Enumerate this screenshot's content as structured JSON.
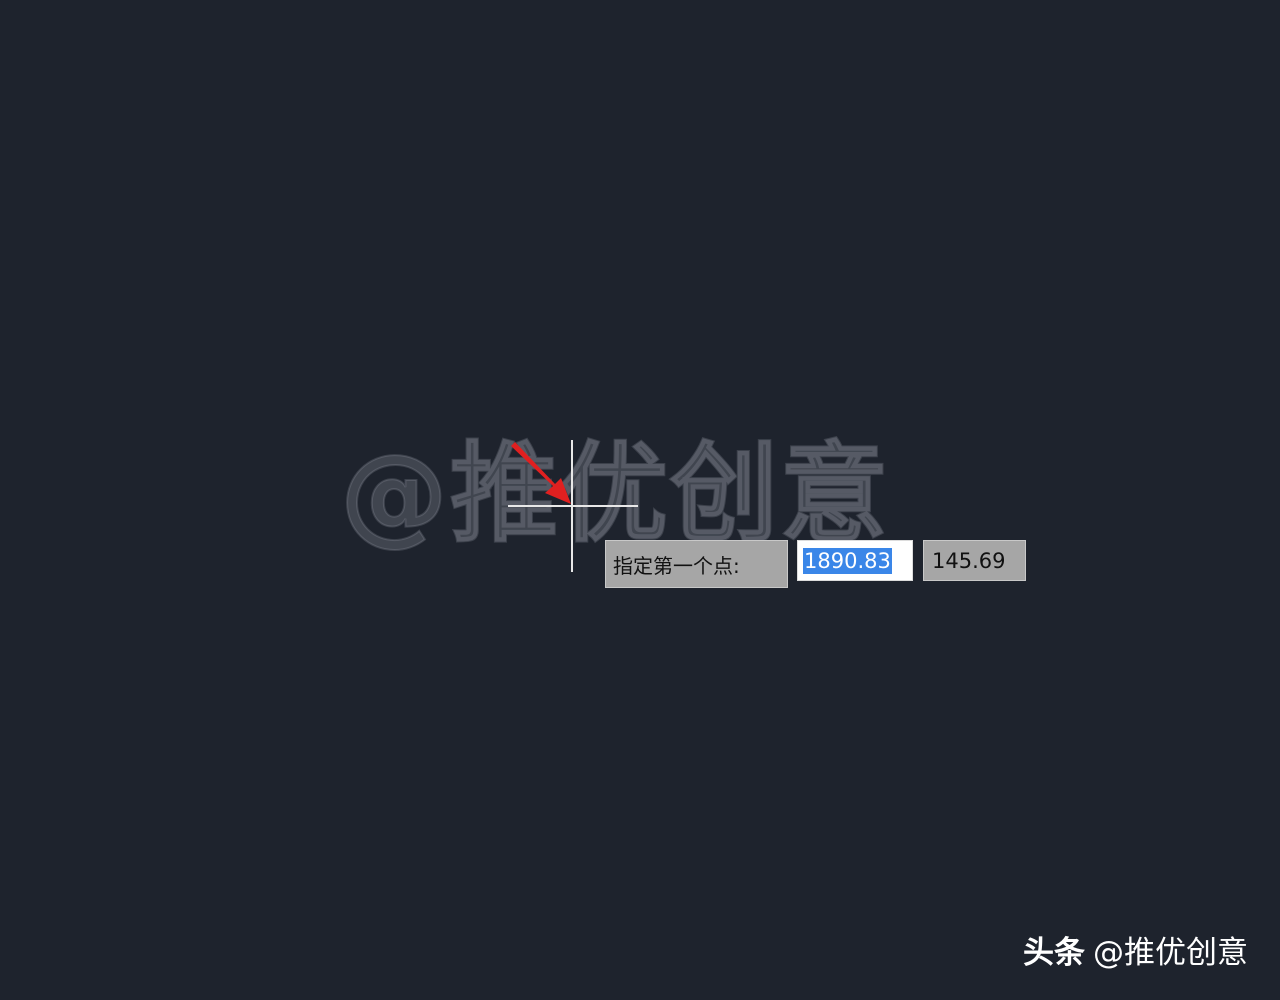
{
  "watermark": {
    "text": "@推优创意"
  },
  "dynamic_input": {
    "prompt": "指定第一个点:",
    "x_value": "1890.83",
    "y_value": "145.69"
  },
  "credit": {
    "brand": "头条",
    "handle": "@推优创意"
  },
  "colors": {
    "background": "#1e232d",
    "crosshair": "#e8e8e8",
    "arrow": "#e02020",
    "selection": "#3a86e8",
    "tooltip": "#a6a6a6"
  },
  "icons": {
    "cursor": "crosshair-icon",
    "pointer": "red-arrow-icon"
  }
}
